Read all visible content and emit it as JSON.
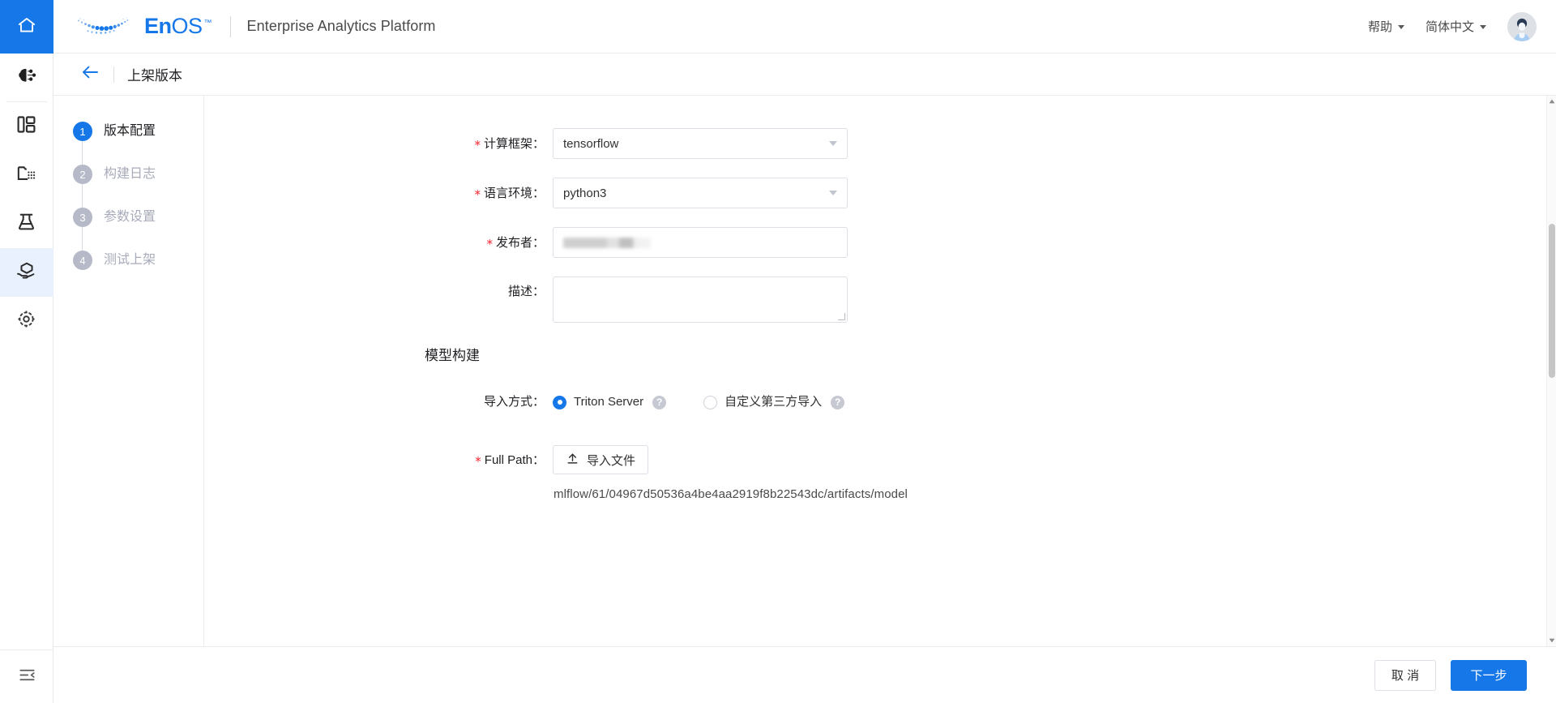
{
  "header": {
    "brand_name_en": "En",
    "brand_name_os": "OS",
    "brand_tm": "™",
    "product_title": "Enterprise Analytics Platform",
    "help_menu": "帮助",
    "language_menu": "简体中文",
    "home_icon": "home-icon",
    "avatar": "user-avatar"
  },
  "subheader": {
    "back_icon": "arrow-left-icon",
    "title": "上架版本"
  },
  "sidebar": {
    "items": [
      {
        "icon": "ai-model-icon",
        "name": "ai-model"
      },
      {
        "icon": "dashboard-icon",
        "name": "dashboard"
      },
      {
        "icon": "folder-data-icon",
        "name": "data-folder"
      },
      {
        "icon": "lab-flask-icon",
        "name": "experiment"
      },
      {
        "icon": "model-serving-icon",
        "name": "model-serving",
        "active": true
      },
      {
        "icon": "settings-gear-icon",
        "name": "settings"
      }
    ],
    "collapse_icon": "collapse-panel-icon"
  },
  "steps": [
    {
      "number": "1",
      "label": "版本配置",
      "active": true
    },
    {
      "number": "2",
      "label": "构建日志",
      "active": false
    },
    {
      "number": "3",
      "label": "参数设置",
      "active": false
    },
    {
      "number": "4",
      "label": "测试上架",
      "active": false
    }
  ],
  "form": {
    "framework": {
      "label": "计算框架：",
      "required": true,
      "value": "tensorflow",
      "chevron": "chevron-down-icon"
    },
    "language": {
      "label": "语言环境：",
      "required": true,
      "value": "python3",
      "chevron": "chevron-down-icon"
    },
    "publisher": {
      "label": "发布者：",
      "required": true,
      "value": "",
      "redacted": true
    },
    "description": {
      "label": "描述：",
      "required": false,
      "value": "",
      "placeholder": ""
    },
    "section_title": "模型构建",
    "import_mode": {
      "label": "导入方式：",
      "options": [
        {
          "label": "Triton Server",
          "checked": true,
          "help": "?"
        },
        {
          "label": "自定义第三方导入",
          "checked": false,
          "help": "?"
        }
      ]
    },
    "full_path": {
      "label": "Full Path：",
      "required": true,
      "upload_button": "导入文件",
      "upload_icon": "upload-icon",
      "path_value": "mlflow/61/04967d50536a4be4aa2919f8b22543dc/artifacts/model"
    }
  },
  "footer": {
    "cancel_label": "取 消",
    "next_label": "下一步"
  },
  "colors": {
    "accent": "#1677e8",
    "required_star": "#f5222d",
    "step_inactive": "#b6bac8",
    "active_rail_bg": "#e8f1fd"
  }
}
